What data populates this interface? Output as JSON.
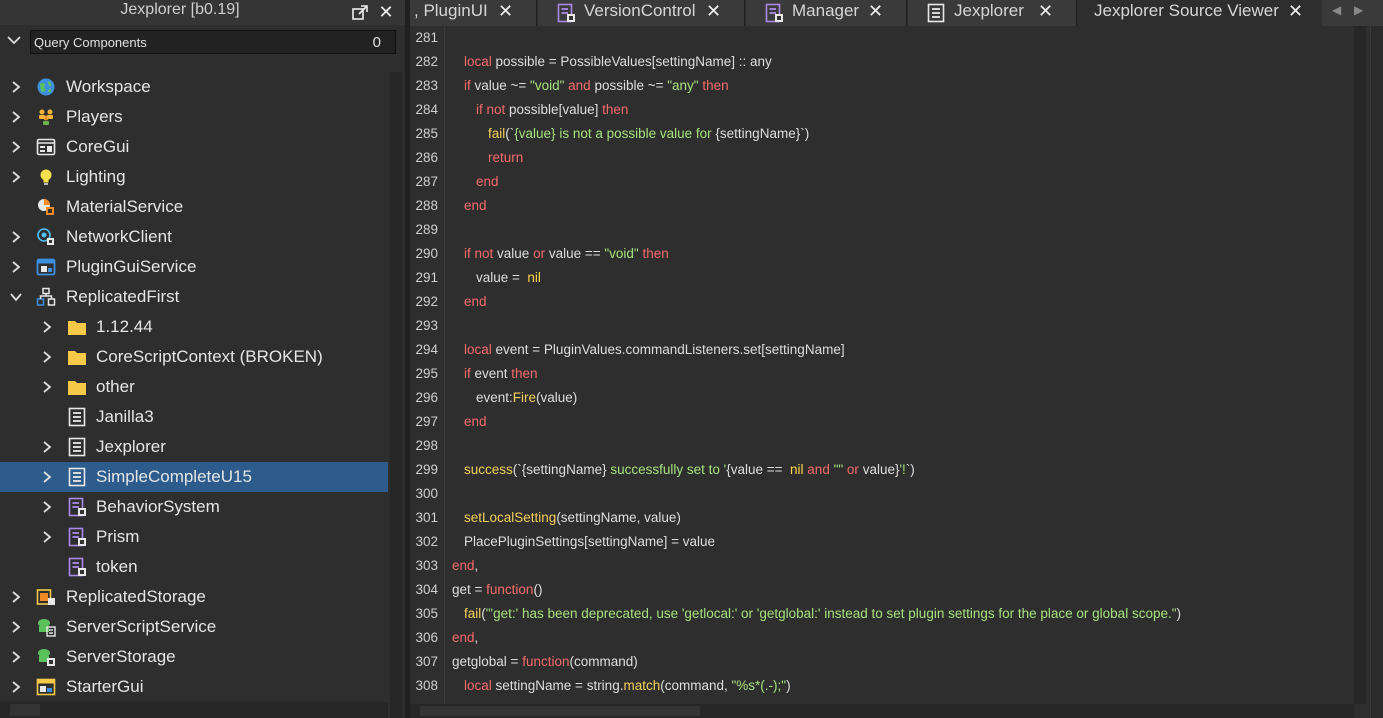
{
  "explorer": {
    "title": "Jexplorer [b0.19]",
    "query_placeholder": "Query Components",
    "query_count": "0",
    "items": [
      {
        "label": "Workspace",
        "icon": "globe-icon"
      },
      {
        "label": "Players",
        "icon": "players-icon"
      },
      {
        "label": "CoreGui",
        "icon": "window-icon"
      },
      {
        "label": "Lighting",
        "icon": "bulb-icon"
      },
      {
        "label": "MaterialService",
        "icon": "material-icon"
      },
      {
        "label": "NetworkClient",
        "icon": "network-icon"
      },
      {
        "label": "PluginGuiService",
        "icon": "plugin-gui-icon"
      },
      {
        "label": "ReplicatedFirst",
        "icon": "replicated-first-icon"
      },
      {
        "label": "1.12.44",
        "icon": "folder-icon"
      },
      {
        "label": "CoreScriptContext (BROKEN)",
        "icon": "folder-icon"
      },
      {
        "label": "other",
        "icon": "folder-icon"
      },
      {
        "label": "Janilla3",
        "icon": "script-icon"
      },
      {
        "label": "Jexplorer",
        "icon": "script-icon"
      },
      {
        "label": "SimpleCompleteU15",
        "icon": "script-icon"
      },
      {
        "label": "BehaviorSystem",
        "icon": "modulescript-icon"
      },
      {
        "label": "Prism",
        "icon": "modulescript-icon"
      },
      {
        "label": "token",
        "icon": "modulescript-icon"
      },
      {
        "label": "ReplicatedStorage",
        "icon": "replicated-storage-icon"
      },
      {
        "label": "ServerScriptService",
        "icon": "server-script-icon"
      },
      {
        "label": "ServerStorage",
        "icon": "server-storage-icon"
      },
      {
        "label": "StarterGui",
        "icon": "starter-gui-icon"
      }
    ]
  },
  "tabs": [
    {
      "label": ", PluginUI",
      "icon": "none"
    },
    {
      "label": "VersionControl",
      "icon": "modulescript-icon"
    },
    {
      "label": "Manager",
      "icon": "modulescript-icon"
    },
    {
      "label": "Jexplorer",
      "icon": "script-icon"
    },
    {
      "label": "Jexplorer Source Viewer",
      "icon": "none",
      "active": true
    }
  ],
  "tab_close_glyph": "✕",
  "tab_nav": {
    "prev": "◀",
    "next": "▶"
  },
  "code": {
    "line_numbers": [
      "281",
      "282",
      "283",
      "284",
      "285",
      "286",
      "287",
      "288",
      "289",
      "290",
      "291",
      "292",
      "293",
      "294",
      "295",
      "296",
      "297",
      "298",
      "299",
      "300",
      "301",
      "302",
      "303",
      "304",
      "305",
      "306",
      "307",
      "308"
    ],
    "lines": [
      [],
      [
        [
          "k",
          "local"
        ],
        [
          "p",
          " possible = PossibleValues[settingName] :: any"
        ]
      ],
      [
        [
          "k",
          "if"
        ],
        [
          "p",
          " value ~= "
        ],
        [
          "s",
          "\"void\""
        ],
        [
          "k",
          " and"
        ],
        [
          "p",
          " possible ~= "
        ],
        [
          "s",
          "\"any\""
        ],
        [
          "k",
          " then"
        ]
      ],
      [
        [
          "k",
          "if not"
        ],
        [
          "p",
          " possible[value] "
        ],
        [
          "k",
          "then"
        ]
      ],
      [
        [
          "f",
          "fail"
        ],
        [
          "p",
          "(`"
        ],
        [
          "s",
          "{value}"
        ],
        [
          "s",
          " is not a possible value for "
        ],
        [
          "p",
          "{settingName}"
        ],
        [
          "p",
          "`)"
        ]
      ],
      [
        [
          "k",
          "return"
        ]
      ],
      [
        [
          "k",
          "end"
        ]
      ],
      [
        [
          "k",
          "end"
        ]
      ],
      [],
      [
        [
          "k",
          "if not"
        ],
        [
          "p",
          " value "
        ],
        [
          "k",
          "or"
        ],
        [
          "p",
          " value == "
        ],
        [
          "s",
          "\"void\""
        ],
        [
          "k",
          " then"
        ]
      ],
      [
        [
          "p",
          "value =  "
        ],
        [
          "n",
          "nil"
        ]
      ],
      [
        [
          "k",
          "end"
        ]
      ],
      [],
      [
        [
          "k",
          "local"
        ],
        [
          "p",
          " event = PluginValues.commandListeners.set[settingName]"
        ]
      ],
      [
        [
          "k",
          "if"
        ],
        [
          "p",
          " event "
        ],
        [
          "k",
          "then"
        ]
      ],
      [
        [
          "p",
          "event:"
        ],
        [
          "f",
          "Fire"
        ],
        [
          "p",
          "(value)"
        ]
      ],
      [
        [
          "k",
          "end"
        ]
      ],
      [],
      [
        [
          "f",
          "success"
        ],
        [
          "p",
          "(`"
        ],
        [
          "p",
          "{settingName}"
        ],
        [
          "s",
          " successfully set to '"
        ],
        [
          "p",
          "{value == "
        ],
        [
          "n",
          " nil"
        ],
        [
          "k",
          " and"
        ],
        [
          "s",
          " \"\""
        ],
        [
          "k",
          " or"
        ],
        [
          "p",
          " value}"
        ],
        [
          "s",
          "'!"
        ],
        [
          "p",
          "`)"
        ]
      ],
      [],
      [
        [
          "f",
          "setLocalSetting"
        ],
        [
          "p",
          "(settingName, value)"
        ]
      ],
      [
        [
          "p",
          "PlacePluginSettings[settingName] = value"
        ]
      ],
      [
        [
          "k",
          "end"
        ],
        [
          "p",
          ","
        ]
      ],
      [
        [
          "p",
          "get = "
        ],
        [
          "k",
          "function"
        ],
        [
          "p",
          "()"
        ]
      ],
      [
        [
          "f",
          "fail"
        ],
        [
          "p",
          "("
        ],
        [
          "s",
          "\"'get:' has been deprecated, use 'getlocal:' or 'getglobal:' instead to set plugin settings for the place or global scope.\""
        ],
        [
          "p",
          ")"
        ]
      ],
      [
        [
          "k",
          "end"
        ],
        [
          "p",
          ","
        ]
      ],
      [
        [
          "p",
          "getglobal = "
        ],
        [
          "k",
          "function"
        ],
        [
          "p",
          "(command)"
        ]
      ],
      [
        [
          "k",
          "local"
        ],
        [
          "p",
          " settingName = string."
        ],
        [
          "f",
          "match"
        ],
        [
          "p",
          "(command, "
        ],
        [
          "s",
          "\"%s*(.-);\""
        ],
        [
          "p",
          ")"
        ]
      ]
    ]
  }
}
